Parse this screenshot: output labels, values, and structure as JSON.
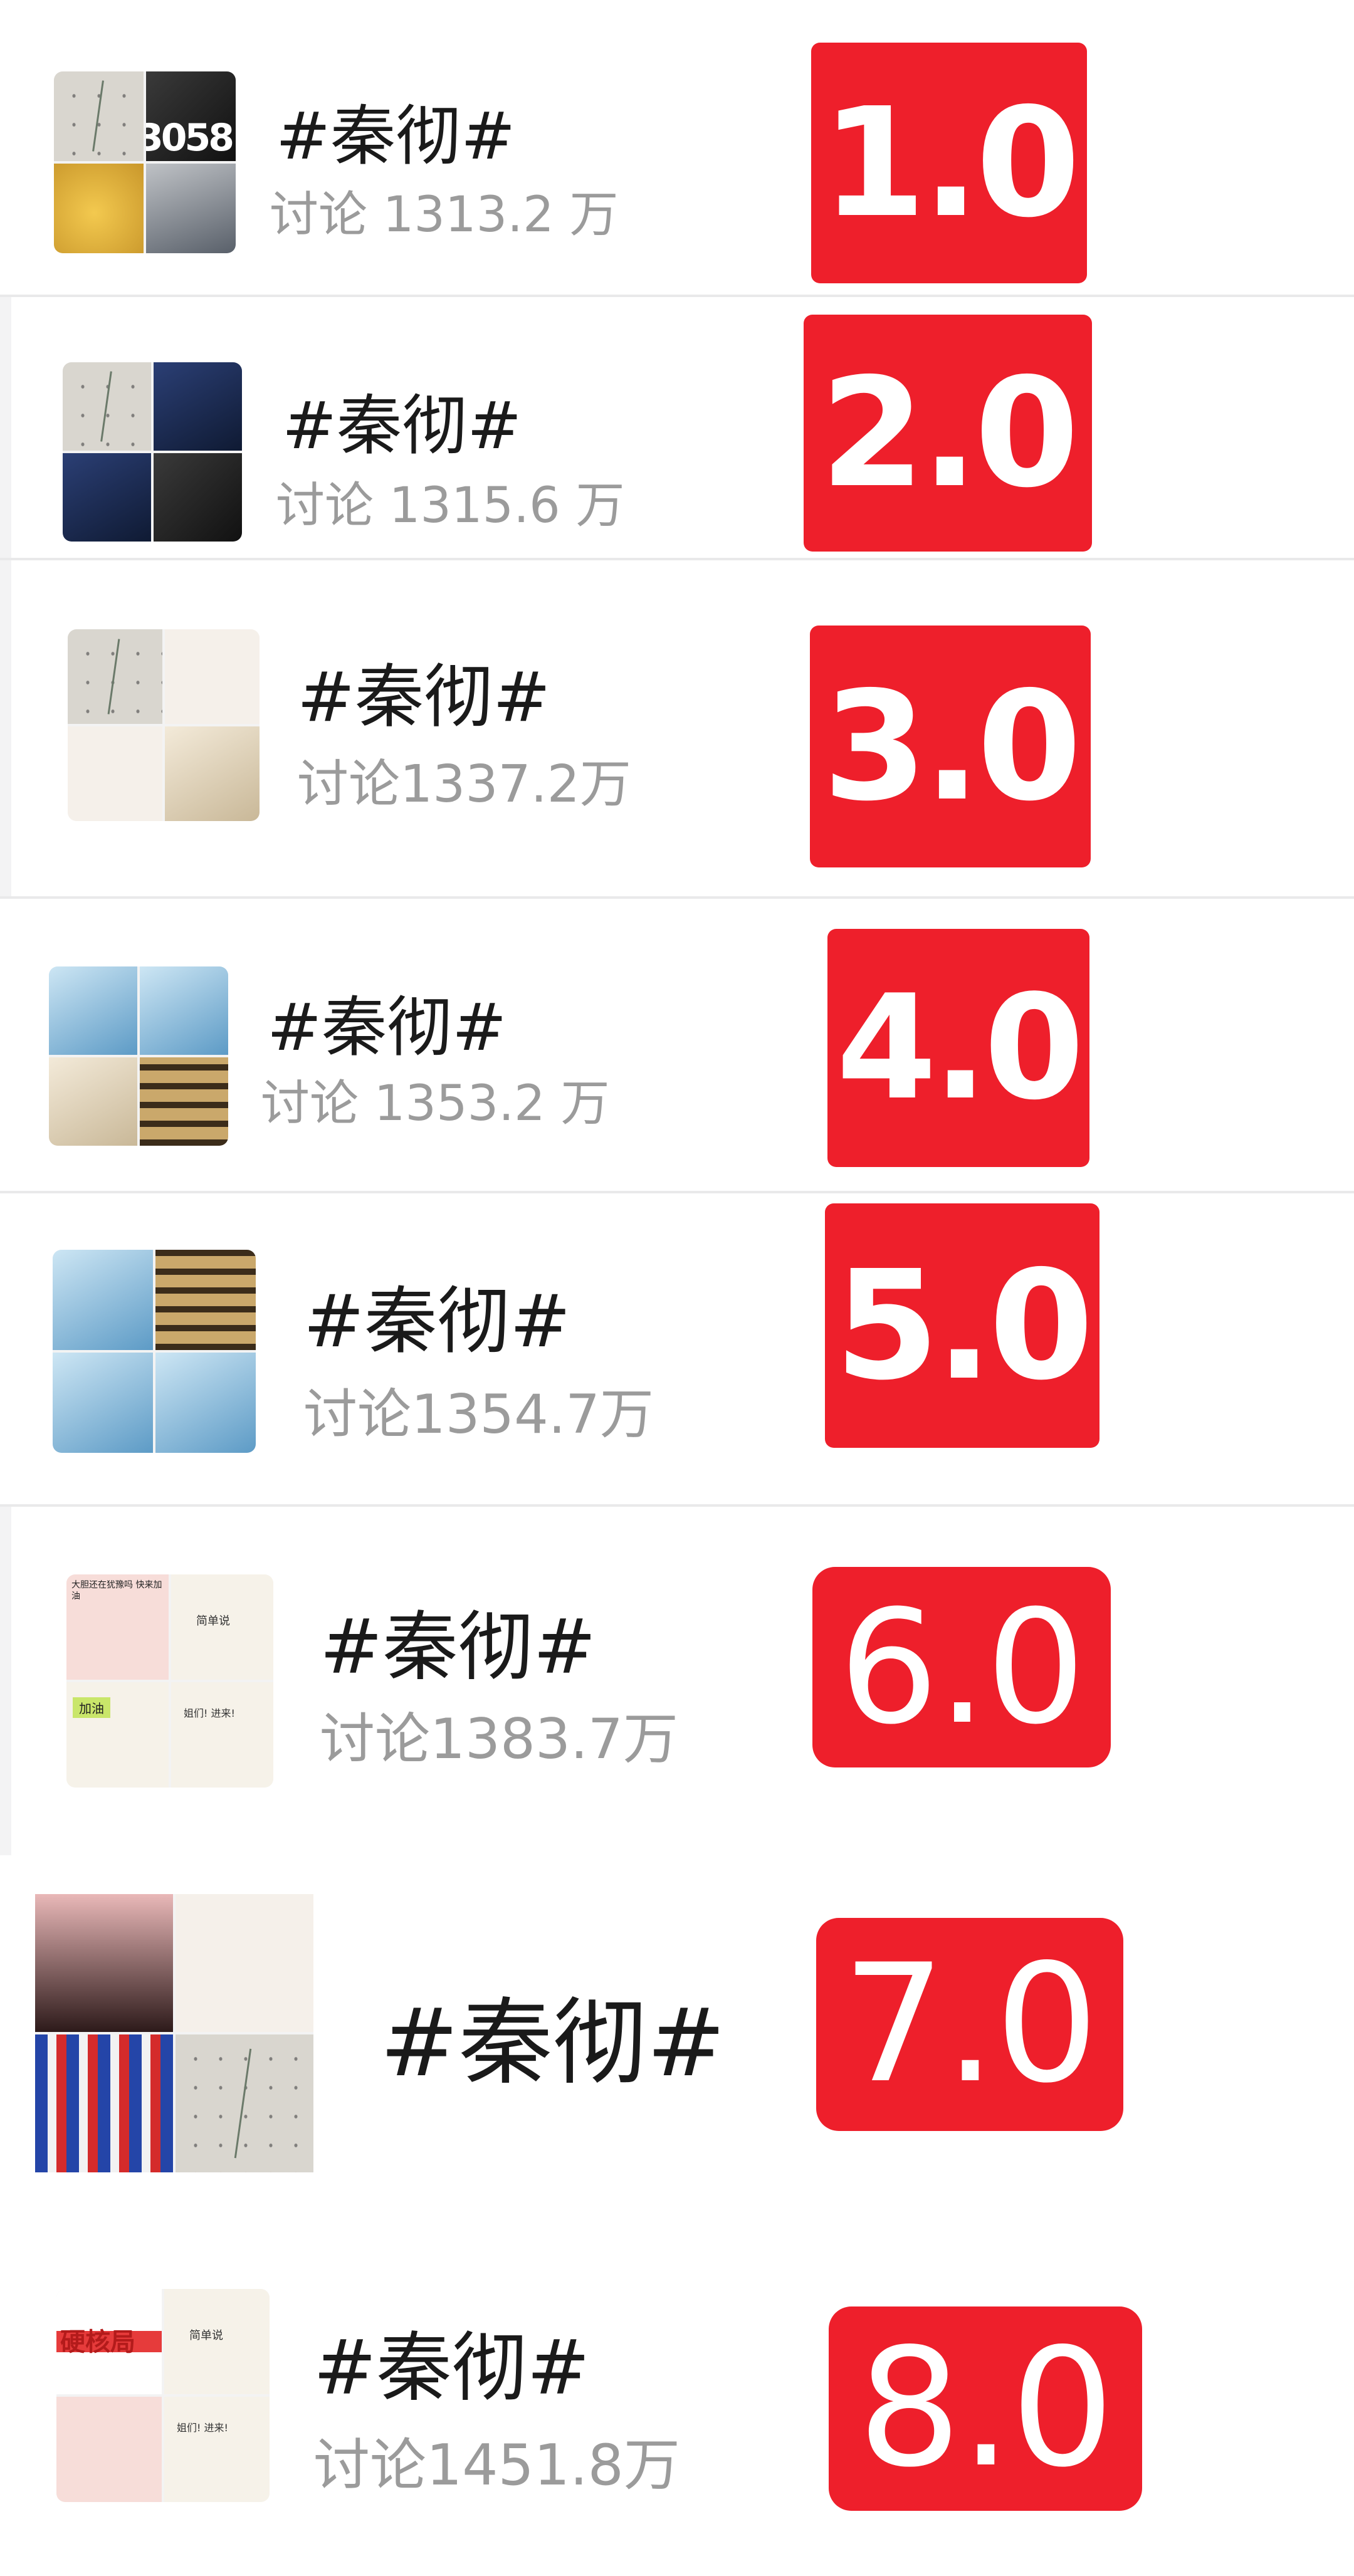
{
  "items": [
    {
      "rank": "1.0",
      "tag": "#秦彻#",
      "discussion": "讨论 1313.2 万"
    },
    {
      "rank": "2.0",
      "tag": "#秦彻#",
      "discussion": "讨论 1315.6 万"
    },
    {
      "rank": "3.0",
      "tag": "#秦彻#",
      "discussion": "讨论1337.2万"
    },
    {
      "rank": "4.0",
      "tag": "#秦彻#",
      "discussion": "讨论 1353.2 万"
    },
    {
      "rank": "5.0",
      "tag": "#秦彻#",
      "discussion": "讨论1354.7万"
    },
    {
      "rank": "6.0",
      "tag": "#秦彻#",
      "discussion": "讨论1383.7万"
    },
    {
      "rank": "7.0",
      "tag": "#秦彻#",
      "discussion": ""
    },
    {
      "rank": "8.0",
      "tag": "#秦彻#",
      "discussion": "讨论1451.8万"
    }
  ],
  "thumbnail_texts": {
    "t1_overlay": "3058",
    "t6_a": "大胆还在犹豫吗 快来加油",
    "t6_b": "简单说",
    "t6_c": "加油",
    "t6_d": "姐们! 进来!",
    "t8_a": "硬核局",
    "t8_b": "简单说",
    "t8_c": "姐们! 进来!"
  },
  "colors": {
    "badge": "#ee1f2b",
    "tag": "#1a1a1a",
    "sub": "#9b9b9b",
    "divider": "#e9e9ea"
  }
}
